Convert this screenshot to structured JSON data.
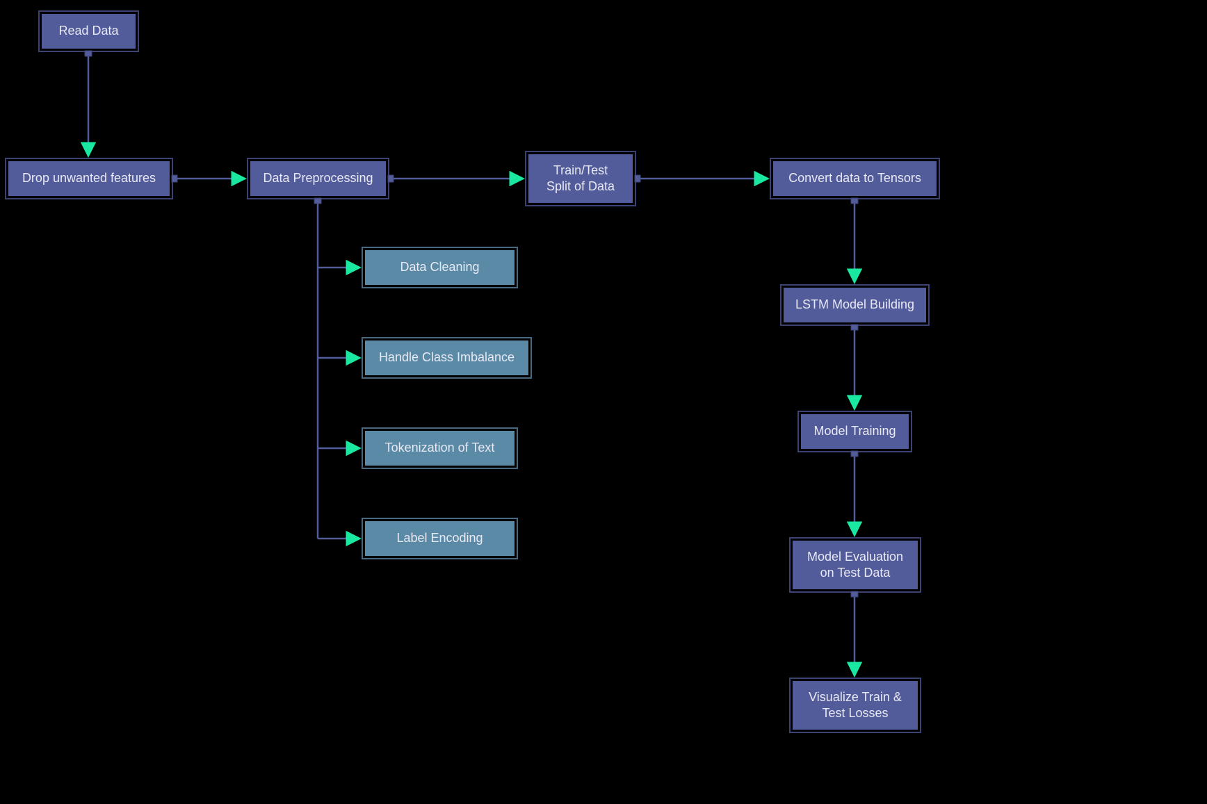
{
  "nodes": {
    "read_data": {
      "label": "Read Data"
    },
    "drop_features": {
      "label": "Drop unwanted features"
    },
    "data_preprocessing": {
      "label": "Data Preprocessing"
    },
    "train_test_split": {
      "label": "Train/Test\nSplit of Data"
    },
    "convert_tensors": {
      "label": "Convert data to Tensors"
    },
    "data_cleaning": {
      "label": "Data Cleaning"
    },
    "class_imbalance": {
      "label": "Handle Class Imbalance"
    },
    "tokenization": {
      "label": "Tokenization of Text"
    },
    "label_encoding": {
      "label": "Label Encoding"
    },
    "lstm_building": {
      "label": "LSTM Model Building"
    },
    "model_training": {
      "label": "Model Training"
    },
    "model_evaluation": {
      "label": "Model Evaluation\non Test Data"
    },
    "visualize_losses": {
      "label": "Visualize Train &\nTest Losses"
    }
  },
  "colors": {
    "primary_bg": "#535c9b",
    "primary_border": "#3c4272",
    "secondary_bg": "#5b8aa6",
    "secondary_border": "#476a80",
    "arrow": "#1ae8a0",
    "edge": "#535c9b",
    "canvas": "#000000"
  }
}
